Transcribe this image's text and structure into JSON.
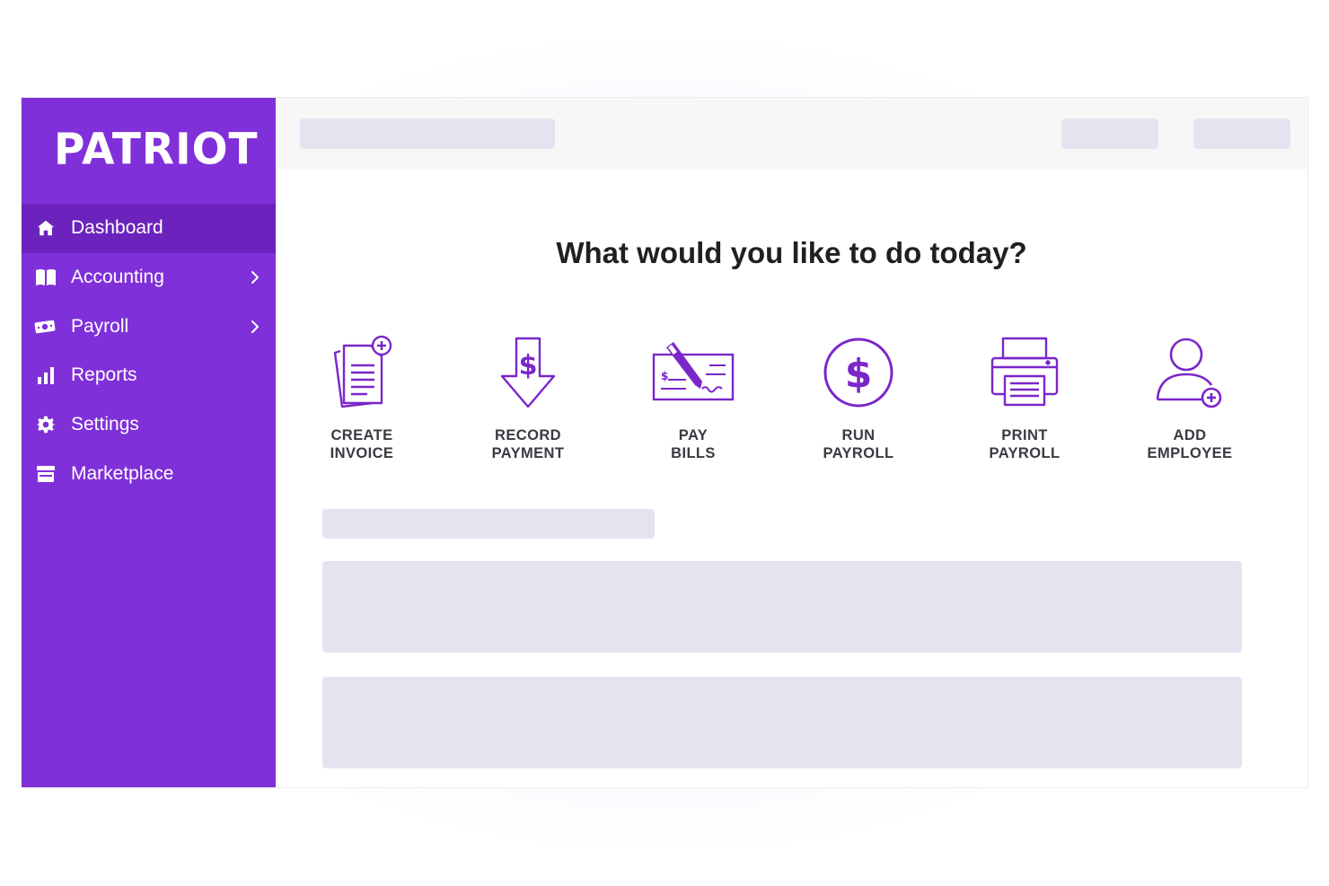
{
  "app": {
    "logo_text": "PATRIOT",
    "accent_color": "#8030d9",
    "active_color": "#6c23bd"
  },
  "sidebar": {
    "items": [
      {
        "label": "Dashboard",
        "icon": "home-icon",
        "active": true,
        "has_submenu": false
      },
      {
        "label": "Accounting",
        "icon": "book-icon",
        "active": false,
        "has_submenu": true
      },
      {
        "label": "Payroll",
        "icon": "money-icon",
        "active": false,
        "has_submenu": true
      },
      {
        "label": "Reports",
        "icon": "bar-chart-icon",
        "active": false,
        "has_submenu": false
      },
      {
        "label": "Settings",
        "icon": "gear-icon",
        "active": false,
        "has_submenu": false
      },
      {
        "label": "Marketplace",
        "icon": "store-icon",
        "active": false,
        "has_submenu": false
      }
    ]
  },
  "main": {
    "heading": "What would you like to do today?",
    "actions": [
      {
        "line1": "CREATE",
        "line2": "INVOICE",
        "icon": "invoice-icon"
      },
      {
        "line1": "RECORD",
        "line2": "PAYMENT",
        "icon": "record-payment-icon"
      },
      {
        "line1": "PAY",
        "line2": "BILLS",
        "icon": "check-pen-icon"
      },
      {
        "line1": "RUN",
        "line2": "PAYROLL",
        "icon": "dollar-circle-icon"
      },
      {
        "line1": "PRINT",
        "line2": "PAYROLL",
        "icon": "printer-icon"
      },
      {
        "line1": "ADD",
        "line2": "EMPLOYEE",
        "icon": "add-user-icon"
      }
    ]
  }
}
